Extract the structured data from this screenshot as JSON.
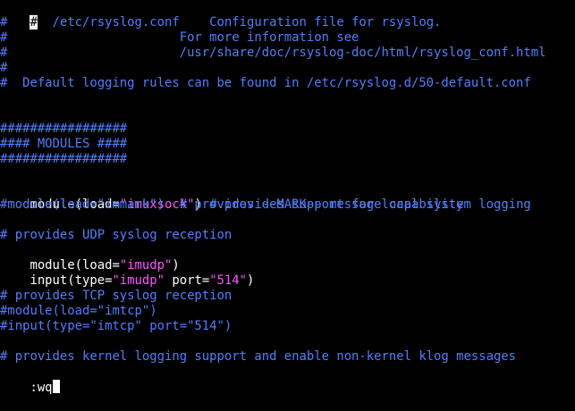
{
  "editor": {
    "app": "vim",
    "file_lines": {
      "l1_cursor": "#",
      "l1_rest": "  /etc/rsyslog.conf    Configuration file for rsyslog.",
      "l2": "#",
      "l3": "#                       For more information see",
      "l4": "#                       /usr/share/doc/rsyslog-doc/html/rsyslog_conf.html",
      "l5": "#",
      "l6": "#  Default logging rules can be found in /etc/rsyslog.d/50-default.conf",
      "l7": "",
      "l8": "",
      "l9": "#################",
      "l10": "#### MODULES ####",
      "l11": "#################",
      "l12": "",
      "l13_a": "module(load=",
      "l13_b": "\"imuxsock\"",
      "l13_c": ")",
      "l13_d": " # provides support for local system logging",
      "l14": "#module(load=\"immark\")  # provides --MARK-- message capability",
      "l15": "",
      "l16": "# provides UDP syslog reception",
      "l17_a": "module(load=",
      "l17_b": "\"imudp\"",
      "l17_c": ")",
      "l18_a": "input(type=",
      "l18_b": "\"imudp\"",
      "l18_c": " port=",
      "l18_d": "\"514\"",
      "l18_e": ")",
      "l19": "",
      "l20": "# provides TCP syslog reception",
      "l21": "#module(load=\"imtcp\")",
      "l22": "#input(type=\"imtcp\" port=\"514\")",
      "l23": "",
      "l24": "# provides kernel logging support and enable non-kernel klog messages"
    },
    "command_line": ":wq"
  },
  "colors": {
    "background": "#000000",
    "comment": "#4f7fff",
    "text": "#ffffff",
    "string": "#ff55ff",
    "cursor": "#ffffff"
  }
}
